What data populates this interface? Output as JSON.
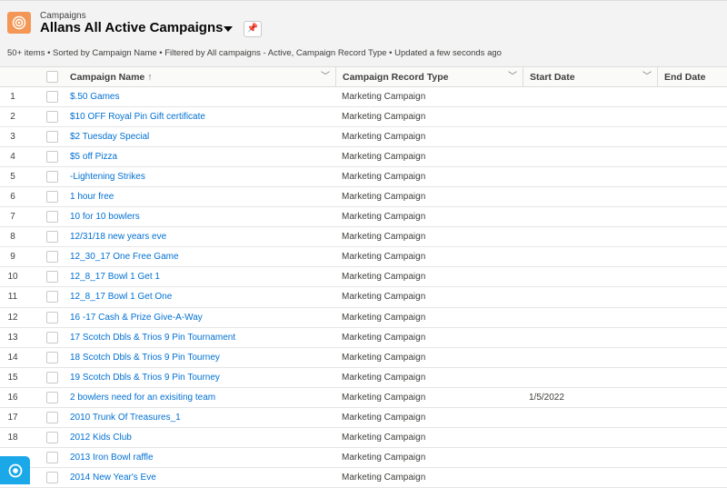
{
  "header": {
    "object": "Campaigns",
    "title": "Allans All Active Campaigns",
    "meta": "50+ items • Sorted by Campaign Name • Filtered by All campaigns - Active, Campaign Record Type • Updated a few seconds ago",
    "brand_color": "#f49756"
  },
  "columns": {
    "name": "Campaign Name",
    "name_sort": "↑",
    "type": "Campaign Record Type",
    "start": "Start Date",
    "end": "End Date"
  },
  "rows": [
    {
      "n": "1",
      "name": "$.50 Games",
      "type": "Marketing Campaign",
      "start": ""
    },
    {
      "n": "2",
      "name": "$10 OFF Royal Pin Gift certificate",
      "type": "Marketing Campaign",
      "start": ""
    },
    {
      "n": "3",
      "name": "$2 Tuesday Special",
      "type": "Marketing Campaign",
      "start": ""
    },
    {
      "n": "4",
      "name": "$5 off Pizza",
      "type": "Marketing Campaign",
      "start": ""
    },
    {
      "n": "5",
      "name": "-Lightening Strikes",
      "type": "Marketing Campaign",
      "start": ""
    },
    {
      "n": "6",
      "name": "1 hour free",
      "type": "Marketing Campaign",
      "start": ""
    },
    {
      "n": "7",
      "name": "10 for 10 bowlers",
      "type": "Marketing Campaign",
      "start": ""
    },
    {
      "n": "8",
      "name": "12/31/18 new years eve",
      "type": "Marketing Campaign",
      "start": ""
    },
    {
      "n": "9",
      "name": "12_30_17 One Free Game",
      "type": "Marketing Campaign",
      "start": ""
    },
    {
      "n": "10",
      "name": "12_8_17 Bowl 1 Get 1",
      "type": "Marketing Campaign",
      "start": ""
    },
    {
      "n": "11",
      "name": "12_8_17 Bowl 1 Get One",
      "type": "Marketing Campaign",
      "start": ""
    },
    {
      "n": "12",
      "name": "16 -17 Cash & Prize Give-A-Way",
      "type": "Marketing Campaign",
      "start": ""
    },
    {
      "n": "13",
      "name": "17 Scotch Dbls & Trios 9 Pin Tournament",
      "type": "Marketing Campaign",
      "start": ""
    },
    {
      "n": "14",
      "name": "18 Scotch Dbls & Trios 9 Pin Tourney",
      "type": "Marketing Campaign",
      "start": ""
    },
    {
      "n": "15",
      "name": "19 Scotch Dbls & Trios 9 Pin Tourney",
      "type": "Marketing Campaign",
      "start": ""
    },
    {
      "n": "16",
      "name": "2 bowlers need for an exisiting team",
      "type": "Marketing Campaign",
      "start": "1/5/2022"
    },
    {
      "n": "17",
      "name": "2010 Trunk Of Treasures_1",
      "type": "Marketing Campaign",
      "start": ""
    },
    {
      "n": "18",
      "name": "2012 Kids Club",
      "type": "Marketing Campaign",
      "start": ""
    },
    {
      "n": "",
      "name": "2013 Iron Bowl raffle",
      "type": "Marketing Campaign",
      "start": ""
    },
    {
      "n": "",
      "name": "2014 New Year's Eve",
      "type": "Marketing Campaign",
      "start": ""
    }
  ]
}
